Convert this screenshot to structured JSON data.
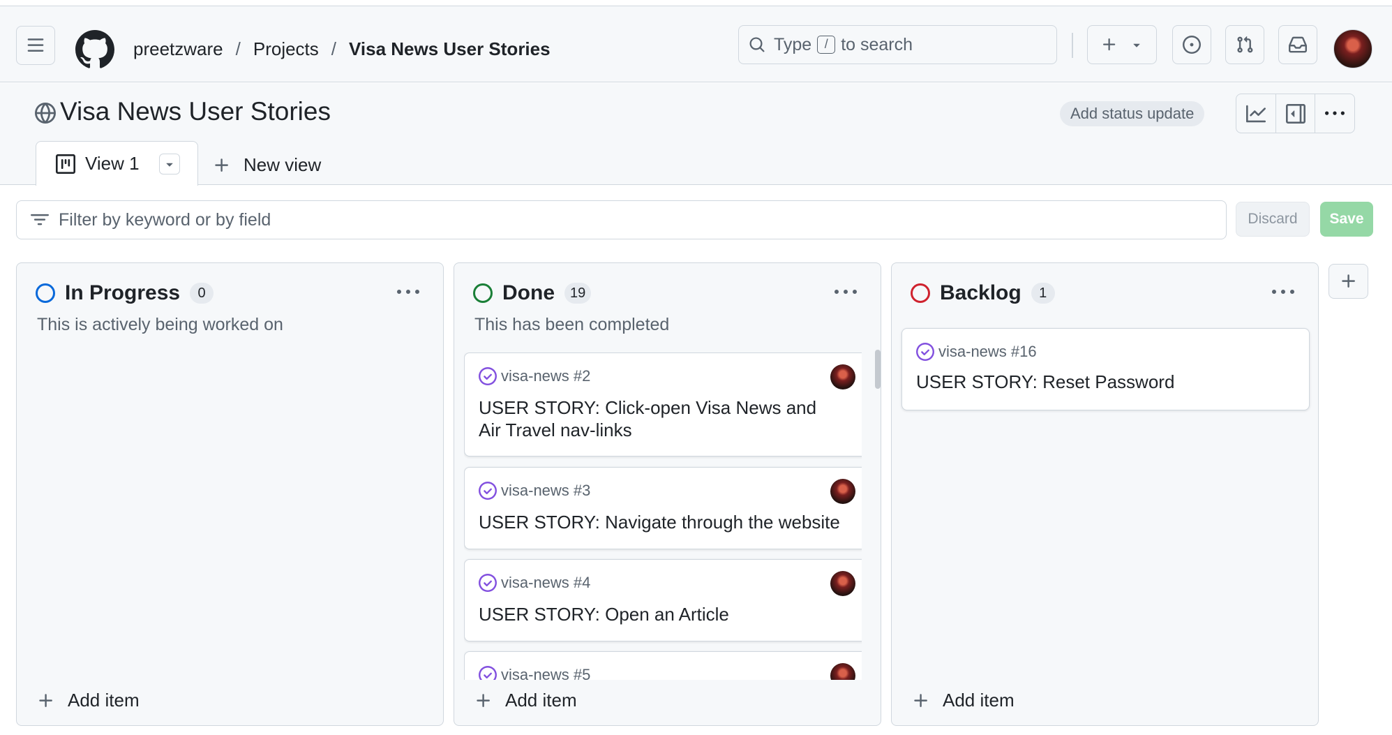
{
  "header": {
    "breadcrumb": [
      "preetzware",
      "Projects",
      "Visa News User Stories"
    ],
    "separator": "/",
    "search": {
      "prefix": "Type",
      "key": "/",
      "suffix": "to search"
    }
  },
  "project": {
    "title": "Visa News User Stories",
    "status_button": "Add status update",
    "tabs": [
      {
        "label": "View 1",
        "active": true
      }
    ],
    "new_view_label": "New view"
  },
  "filter": {
    "placeholder": "Filter by keyword or by field",
    "discard_label": "Discard",
    "save_label": "Save"
  },
  "columns": [
    {
      "title": "In Progress",
      "count": "0",
      "color": "#0969da",
      "description": "This is actively being worked on",
      "add_item_label": "Add item",
      "items": []
    },
    {
      "title": "Done",
      "count": "19",
      "color": "#1a7f37",
      "description": "This has been completed",
      "add_item_label": "Add item",
      "items": [
        {
          "ref": "visa-news #2",
          "title": "USER STORY: Click-open Visa News and Air Travel nav-links"
        },
        {
          "ref": "visa-news #3",
          "title": "USER STORY: Navigate through the website"
        },
        {
          "ref": "visa-news #4",
          "title": "USER STORY: Open an Article"
        },
        {
          "ref": "visa-news #5",
          "title": ""
        }
      ]
    },
    {
      "title": "Backlog",
      "count": "1",
      "color": "#cf222e",
      "description": "",
      "add_item_label": "Add item",
      "items": [
        {
          "ref": "visa-news #16",
          "title": "USER STORY: Reset Password"
        }
      ]
    }
  ],
  "icons": {
    "hamburger": "hamburger-icon",
    "logo": "github-logo-icon",
    "search": "search-icon",
    "plus": "plus-icon",
    "issues": "issue-opened-icon",
    "pulls": "git-pull-request-icon",
    "inbox": "inbox-icon",
    "globe": "globe-icon",
    "insights": "graph-icon",
    "sidepanel": "sidebar-expand-icon",
    "more": "kebab-horizontal-icon",
    "board": "project-board-icon",
    "filter": "filter-icon",
    "completed": "check-circle-icon"
  },
  "colors": {
    "completed_purple": "#8250df",
    "save_disabled": "#95d8a6"
  }
}
